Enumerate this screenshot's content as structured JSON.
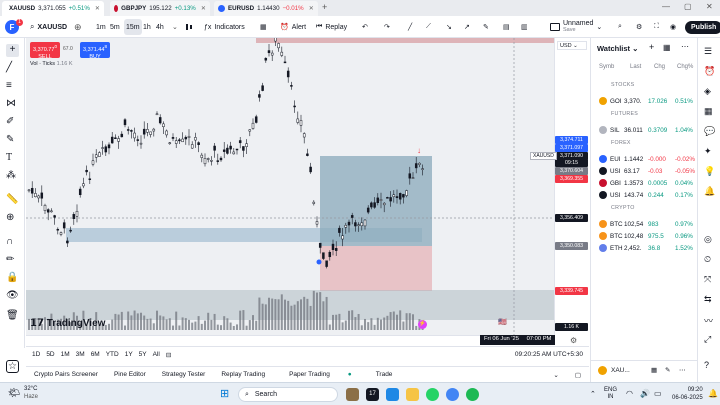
{
  "tabs": [
    {
      "symbol": "XAUUSD",
      "price": "3,371.055",
      "change": "+0.51%"
    },
    {
      "symbol": "GBPJPY",
      "price": "195.122",
      "change": "+0.13%"
    },
    {
      "symbol": "EURUSD",
      "price": "1.14430",
      "change": "−0.01%"
    }
  ],
  "header": {
    "symbol": "XAUUSD",
    "timeframes": [
      "1m",
      "5m",
      "15m",
      "1h",
      "4h"
    ],
    "indicators": "Indicators",
    "alert": "Alert",
    "replay": "Replay",
    "layout_name": "Unnamed",
    "layout_sub": "Save",
    "publish": "Publish",
    "logo_badge": "1"
  },
  "chart": {
    "sell_price": "3,370.77",
    "sell_price_sup": "0",
    "sell_label": "SELL",
    "spread": "67.0",
    "buy_price": "3,371.44",
    "buy_price_sup": "8",
    "buy_label": "BUY",
    "vol_label": "Vol · Ticks",
    "vol_value": "1.16 K",
    "watermark": "TradingView",
    "crosshair_date": "Fri 06 Jun '25",
    "crosshair_time": "07:00 PM",
    "currency": "USD",
    "ticker_tag": "XAUUSD",
    "price_labels": [
      {
        "text": "3,374.711",
        "color": "#2962ff"
      },
      {
        "text": "3,371.097",
        "color": "#2962ff"
      },
      {
        "text": "3,371.090",
        "color": "#ffffff"
      },
      {
        "text": "09:15",
        "color": "#ffffff"
      },
      {
        "text": "3,370.604",
        "color": "#787b86"
      },
      {
        "text": "3,369.355",
        "color": "#f23645"
      },
      {
        "text": "3,356.409",
        "color": "#131722"
      },
      {
        "text": "3,350.083",
        "color": "#787b86"
      },
      {
        "text": "3,339.745",
        "color": "#f23645"
      },
      {
        "text": "1.16 K",
        "color": "#131722"
      }
    ]
  },
  "range_bar": {
    "ranges": [
      "1D",
      "5D",
      "1M",
      "3M",
      "6M",
      "YTD",
      "1Y",
      "5Y",
      "All"
    ],
    "clock": "09:20:25 AM UTC+5:30"
  },
  "bottom_tabs": [
    "Crypto Pairs Screener",
    "Pine Editor",
    "Strategy Tester",
    "Replay Trading",
    "Paper Trading",
    "Trade"
  ],
  "watchlist": {
    "title": "Watchlist",
    "columns": [
      "Symb",
      "Last",
      "Chg",
      "Chg%"
    ],
    "sections": [
      {
        "name": "STOCKS",
        "rows": [
          {
            "sym": "GOI",
            "last": "3,370.",
            "chg": "17.026",
            "pct": "0.51%",
            "color": "#f0a200",
            "dir": "up"
          }
        ]
      },
      {
        "name": "FUTURES",
        "rows": [
          {
            "sym": "SIL",
            "last": "36.011",
            "chg": "0.3709",
            "pct": "1.04%",
            "color": "#b2b5be",
            "dir": "up"
          }
        ]
      },
      {
        "name": "FOREX",
        "rows": [
          {
            "sym": "EUI",
            "last": "1.1442",
            "chg": "-0.000",
            "pct": "-0.02%",
            "color": "#2962ff",
            "dir": "dn"
          },
          {
            "sym": "USI",
            "last": "63.17",
            "chg": "-0.03",
            "pct": "-0.05%",
            "color": "#131722",
            "dir": "dn"
          },
          {
            "sym": "GBI",
            "last": "1.3573",
            "chg": "0.0005",
            "pct": "0.04%",
            "color": "#c8102e",
            "dir": "up"
          },
          {
            "sym": "USI",
            "last": "143.74",
            "chg": "0.244",
            "pct": "0.17%",
            "color": "#131722",
            "dir": "up"
          }
        ]
      },
      {
        "name": "CRYPTO",
        "rows": [
          {
            "sym": "BTC",
            "last": "102,54",
            "chg": "983",
            "pct": "0.97%",
            "color": "#f7931a",
            "dir": "up"
          },
          {
            "sym": "BTC",
            "last": "102,48",
            "chg": "975.5",
            "pct": "0.96%",
            "color": "#f7931a",
            "dir": "up"
          },
          {
            "sym": "ETH",
            "last": "2,452.",
            "chg": "36.8",
            "pct": "1.52%",
            "color": "#627eea",
            "dir": "up"
          }
        ]
      }
    ],
    "footer_symbol": "XAU..."
  },
  "taskbar": {
    "temp": "32°C",
    "weather": "Haze",
    "search": "Search",
    "lang1": "ENG",
    "lang2": "IN",
    "time": "09:20",
    "date": "06-06-2025"
  },
  "colors": {
    "up": "#089981",
    "down": "#f23645",
    "accent": "#2962ff",
    "box": "#90a4ae"
  }
}
